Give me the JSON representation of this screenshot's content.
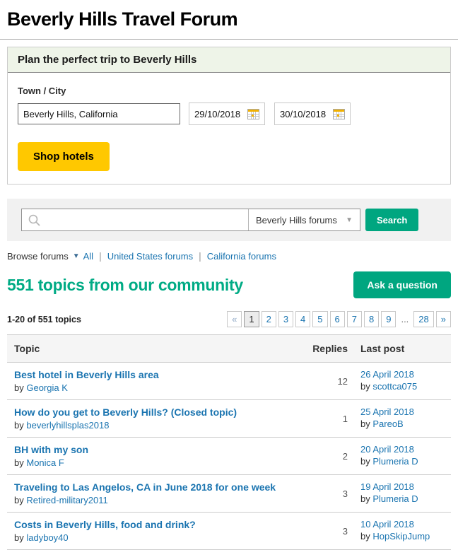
{
  "colors": {
    "green": "#00a680",
    "yellow": "#ffc800",
    "link": "#1a74b0"
  },
  "page_title": "Beverly Hills Travel Forum",
  "trip_planner": {
    "header": "Plan the perfect trip to Beverly Hills",
    "town_city_label": "Town / City",
    "town_city_value": "Beverly Hills, California",
    "checkin_value": "29/10/2018",
    "checkout_value": "30/10/2018",
    "shop_hotels_label": "Shop hotels"
  },
  "forum_search": {
    "input_value": "",
    "scope_selected": "Beverly Hills forums",
    "scope_arrow": "▼",
    "search_button_label": "Search"
  },
  "browse": {
    "label": "Browse forums",
    "arrow": "▼",
    "separator": "|",
    "links": {
      "0": "All",
      "1": "United States forums",
      "2": "California forums"
    }
  },
  "community": {
    "heading": "551 topics from our community",
    "ask_button_label": "Ask a question"
  },
  "topics": {
    "count_label": "1-20 of 551 topics",
    "by_label": "by",
    "pagination": {
      "prev": "«",
      "current": "1",
      "pages": [
        "2",
        "3",
        "4",
        "5",
        "6",
        "7",
        "8",
        "9"
      ],
      "ellipsis": "...",
      "last_page": "28",
      "next": "»"
    },
    "columns": {
      "topic": "Topic",
      "replies": "Replies",
      "last_post": "Last post"
    },
    "rows": [
      {
        "title": "Best hotel in Beverly Hills area",
        "author": "Georgia K",
        "replies": "12",
        "last_date": "26 April 2018",
        "last_author": "scottca075"
      },
      {
        "title": "How do you get to Beverly Hills? (Closed topic)",
        "author": "beverlyhillsplas2018",
        "replies": "1",
        "last_date": "25 April 2018",
        "last_author": "PareoB"
      },
      {
        "title": "BH with my son",
        "author": "Monica F",
        "replies": "2",
        "last_date": "20 April 2018",
        "last_author": "Plumeria D"
      },
      {
        "title": "Traveling to Las Angelos, CA in June 2018 for one week",
        "author": "Retired-military2011",
        "replies": "3",
        "last_date": "19 April 2018",
        "last_author": "Plumeria D"
      },
      {
        "title": "Costs in Beverly Hills, food and drink?",
        "author": "ladyboy40",
        "replies": "3",
        "last_date": "10 April 2018",
        "last_author": "HopSkipJump"
      }
    ]
  }
}
